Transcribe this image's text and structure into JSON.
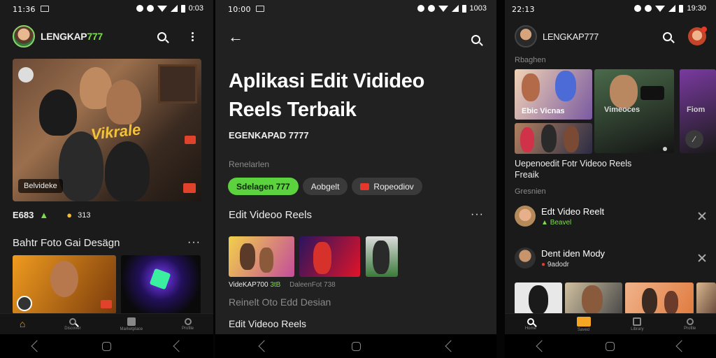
{
  "screen1": {
    "status_time": "11:36",
    "status_right": "0:03",
    "brand_prefix": "LENGKAP",
    "brand_suffix": "777",
    "hero_overlay_text": "Vikrale",
    "hero_chip": "Belvideke",
    "stats_left": "E683",
    "stats_right": "313",
    "section_title": "Bahtr Foto Gai Desägn",
    "tabs": [
      "",
      "Discover",
      "Marketplace",
      "Profile"
    ]
  },
  "screen2": {
    "status_time": "10:00",
    "status_right": "1003",
    "title_line1": "Aplikasi Edit Vidideo",
    "title_line2": "Reels Terbaik",
    "author": "EGENKAPAD 7777",
    "label_related": "Renelarlen",
    "chips": [
      "Sdelagen 777",
      "Aobgelt",
      "Ropeodiov"
    ],
    "section1_title": "Edit Videoo Reels",
    "thumb_caption_left": "VideKAP700",
    "thumb_caption_green": "3tB",
    "thumb_caption_right": "DaleenFot 738",
    "section2_title": "Reinelt Oto Edd Desian",
    "section3_title": "Edit Videoo Reels"
  },
  "screen3": {
    "status_time": "22:13",
    "status_right": "19:30",
    "brand": "LENGKAP777",
    "label_top": "Rbaghen",
    "card_text_1": "Ebic Vicnas",
    "card_text_2": "Vimeoces",
    "card_text_3": "Fiom",
    "headline_line1": "Uepenoedit Fotr Videoo Reels",
    "headline_line2": "Freaik",
    "label_section": "Gresnien",
    "list": [
      {
        "title": "Edt Video Reelt",
        "sub": "Beavel"
      },
      {
        "title": "Dent iden Mody",
        "sub": "9adodr"
      }
    ],
    "tabs": [
      "Home",
      "Saved",
      "Library",
      "Profile"
    ]
  },
  "colors": {
    "accent_green": "#7ddc4f",
    "bg_dark": "#1e1e1e"
  }
}
